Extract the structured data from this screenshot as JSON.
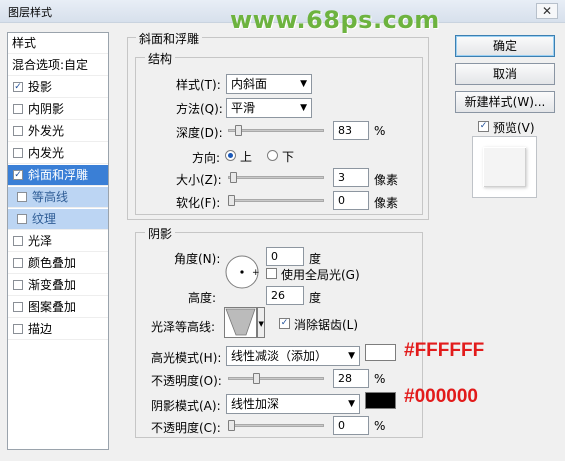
{
  "window": {
    "title": "图层样式",
    "close": "✕",
    "watermark": "www.68ps.com"
  },
  "left_panel": {
    "header": "样式",
    "blend_options": "混合选项:自定",
    "items": [
      {
        "label": "投影",
        "checked": true
      },
      {
        "label": "内阴影",
        "checked": false
      },
      {
        "label": "外发光",
        "checked": false
      },
      {
        "label": "内发光",
        "checked": false
      },
      {
        "label": "斜面和浮雕",
        "checked": true
      },
      {
        "label": "等高线",
        "checked": false
      },
      {
        "label": "纹理",
        "checked": false
      },
      {
        "label": "光泽",
        "checked": false
      },
      {
        "label": "颜色叠加",
        "checked": false
      },
      {
        "label": "渐变叠加",
        "checked": false
      },
      {
        "label": "图案叠加",
        "checked": false
      },
      {
        "label": "描边",
        "checked": false
      }
    ]
  },
  "bevel": {
    "section": "斜面和浮雕",
    "structure": "结构",
    "style_label": "样式(T):",
    "style_value": "内斜面",
    "technique_label": "方法(Q):",
    "technique_value": "平滑",
    "depth_label": "深度(D):",
    "depth_value": "83",
    "depth_unit": "%",
    "depth_level": 0.08,
    "direction_label": "方向:",
    "dir_up": "上",
    "dir_down": "下",
    "size_label": "大小(Z):",
    "size_value": "3",
    "size_unit": "像素",
    "size_level": 0.02,
    "soften_label": "软化(F):",
    "soften_value": "0",
    "soften_unit": "像素",
    "soften_level": 0.0
  },
  "shading": {
    "section": "阴影",
    "angle_label": "角度(N):",
    "angle_value": "0",
    "angle_unit": "度",
    "global_light": "使用全局光(G)",
    "altitude_label": "高度:",
    "altitude_value": "26",
    "altitude_unit": "度",
    "gloss_label": "光泽等高线:",
    "anti_alias": "消除锯齿(L)",
    "highlight_label": "高光模式(H):",
    "highlight_value": "线性减淡（添加）",
    "highlight_color": "#FFFFFF",
    "hl_opacity_label": "不透明度(O):",
    "hl_opacity_value": "28",
    "hl_opacity_unit": "%",
    "hl_opacity_level": 0.28,
    "shadow_label": "阴影模式(A):",
    "shadow_value": "线性加深",
    "shadow_color": "#000000",
    "sh_opacity_label": "不透明度(C):",
    "sh_opacity_value": "0",
    "sh_opacity_unit": "%",
    "sh_opacity_level": 0.0
  },
  "annotations": {
    "highlight_hex": "#FFFFFF",
    "shadow_hex": "#000000"
  },
  "buttons": {
    "ok": "确定",
    "cancel": "取消",
    "new_style": "新建样式(W)...",
    "preview": "预览(V)"
  }
}
